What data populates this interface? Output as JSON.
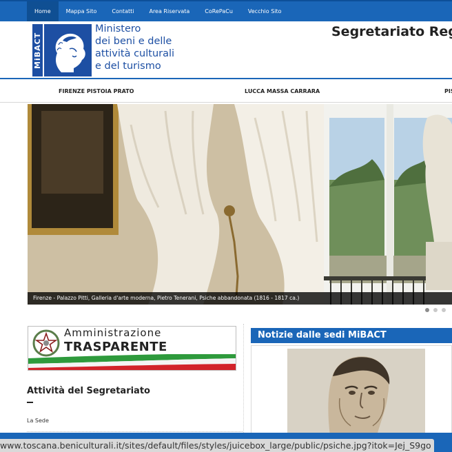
{
  "topnav": {
    "items": [
      {
        "label": "Home",
        "active": true
      },
      {
        "label": "Mappa Sito"
      },
      {
        "label": "Contatti"
      },
      {
        "label": "Area Riservata"
      },
      {
        "label": "CoRePaCu"
      },
      {
        "label": "Vecchio Sito"
      }
    ]
  },
  "header": {
    "logo_text": "MiBACT",
    "ministry_lines": [
      "Ministero",
      "dei beni e delle",
      "attività culturali",
      "e del turismo"
    ],
    "site_title": "Segretariato Regio"
  },
  "regionnav": {
    "items": [
      {
        "label": "FIRENZE PISTOIA PRATO"
      },
      {
        "label": "LUCCA MASSA CARRARA"
      },
      {
        "label": "PIS"
      }
    ]
  },
  "slideshow": {
    "caption": "Firenze - Palazzo Pitti, Galleria d'arte moderna, Pietro Tenerani, Psiche abbandonata (1816 - 1817 ca.)",
    "dots": 3,
    "active_dot": 1
  },
  "trasparente": {
    "top_text": "Amministrazione",
    "big_text": "TRASPARENTE"
  },
  "left": {
    "section_title": "Attività del Segretariato",
    "link": "La Sede"
  },
  "news": {
    "title": "Notizie dalle sedi MiBACT"
  },
  "statusbar": {
    "url": "www.toscana.beniculturali.it/sites/default/files/styles/juicebox_large/public/psiche.jpg?itok=Jej_S9go"
  },
  "colors": {
    "primary": "#1a66b8",
    "logo_blue": "#1d4fa3"
  }
}
